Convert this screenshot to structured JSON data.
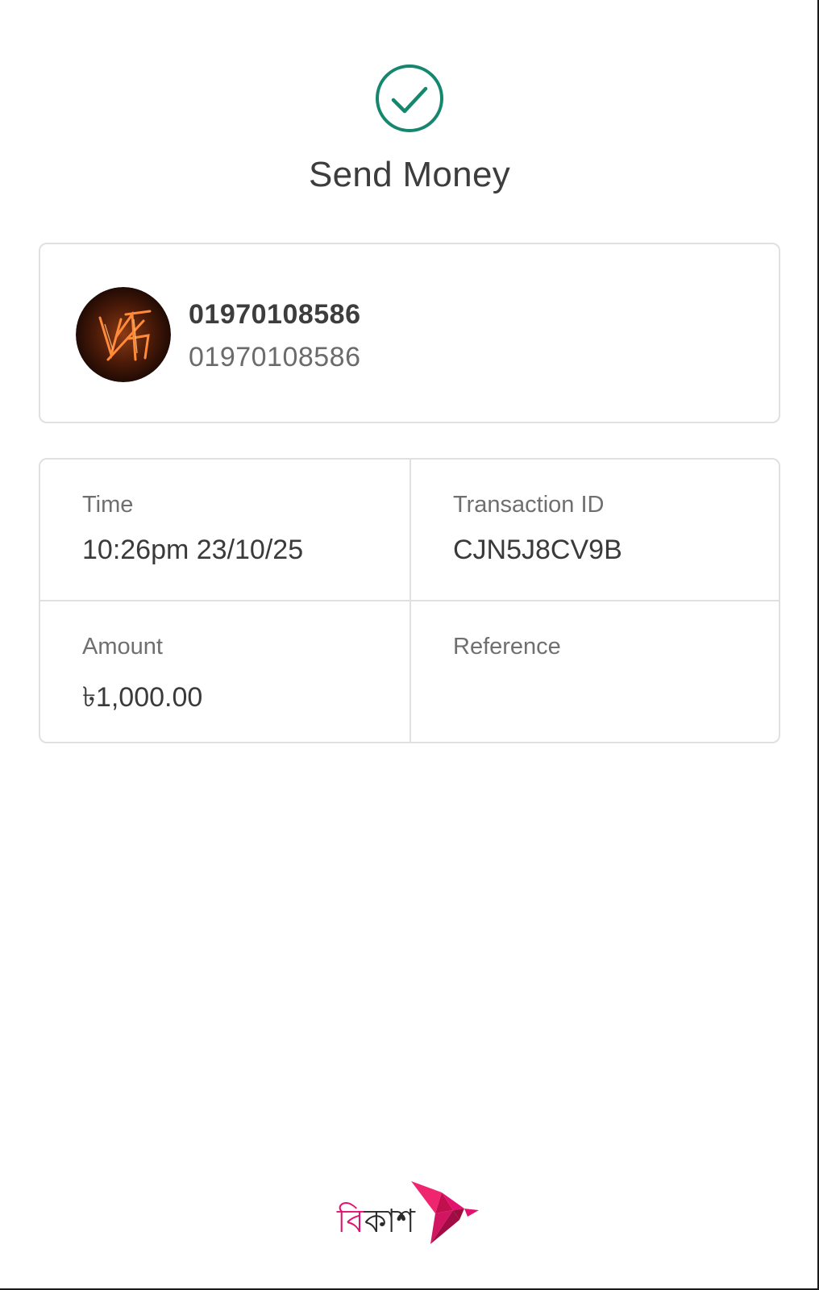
{
  "status": {
    "icon": "check-circle-icon",
    "color": "#16876f"
  },
  "header": {
    "title": "Send Money"
  },
  "recipient": {
    "name": "01970108586",
    "number": "01970108586",
    "avatar": "avatar-image"
  },
  "details": {
    "time_label": "Time",
    "time_value": "10:26pm 23/10/25",
    "txn_label": "Transaction ID",
    "txn_value": "CJN5J8CV9B",
    "amount_label": "Amount",
    "amount_value": "৳1,000.00",
    "reference_label": "Reference",
    "reference_value": ""
  },
  "brand": {
    "logo_text_first": "বি",
    "logo_text_rest": "কাশ",
    "accent": "#e2136e"
  }
}
